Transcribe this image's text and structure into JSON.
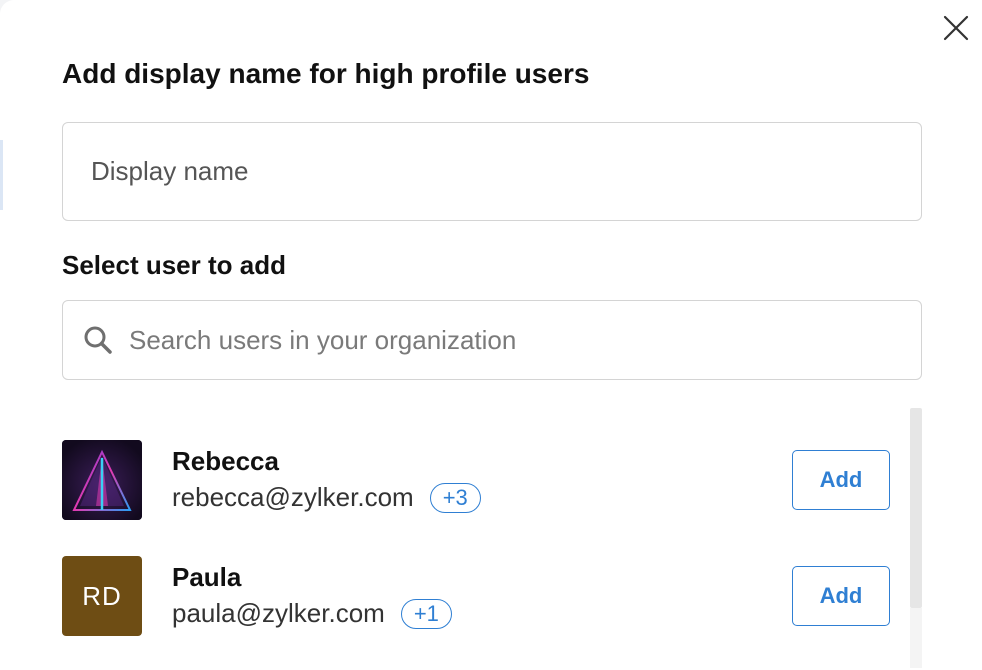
{
  "dialog": {
    "title": "Add display name for high profile users",
    "display_name_placeholder": "Display name",
    "select_label": "Select user to add",
    "search_placeholder": "Search users in your organization"
  },
  "users": [
    {
      "name": "Rebecca",
      "email": "rebecca@zylker.com",
      "extra_count": "+3",
      "avatar": "image",
      "add_label": "Add"
    },
    {
      "name": "Paula",
      "email": "paula@zylker.com",
      "extra_count": "+1",
      "avatar_initials": "RD",
      "avatar_color": "#6e4d14",
      "add_label": "Add"
    }
  ],
  "colors": {
    "accent": "#2f7fd3",
    "text": "#111111",
    "border": "#d4d4d4"
  },
  "icons": [
    "close-icon",
    "search-icon"
  ]
}
